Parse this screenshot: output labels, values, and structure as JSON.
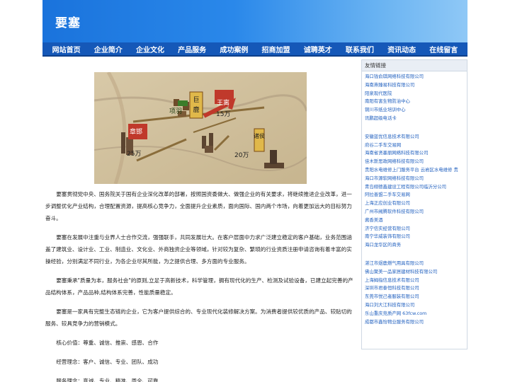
{
  "site": {
    "brand": "要塞"
  },
  "nav": [
    "网站首页",
    "企业简介",
    "企业文化",
    "产品服务",
    "成功案例",
    "招商加盟",
    "诚聘英才",
    "联系我们",
    "资讯动态",
    "在线留言"
  ],
  "hero": {
    "labels": {
      "a": "项羽",
      "b": "巨鹿",
      "c": "王离",
      "d": "15万",
      "e": "章邯",
      "f": "25万",
      "g": "诸侯",
      "h": "20万"
    }
  },
  "paragraphs": [
    "要塞贯彻党中央、国务院关于国有企业深化改革的部署，按照国资委做大、做强企业的有关要求，将继续推进企业改革，进一步调整优化产业结构，合理配置资源，提高核心竞争力，全面提升企业素质，面向国际、国内两个市场，向着更加远大的目标努力奋斗。",
    "要塞在发展中注重与业界人士合作交流，强强联手，共同发展壮大。在客户层面中力求广泛建立稳定的客户基础，业务范围涵盖了建筑业、设计业、工业、制造业、文化业、外商独资企业等领域，针对较为复杂、繁琐的行业资质注册申请咨询有着丰富的实操经验，分别满足不同行业，为各企业尽其所能，为之提供合理、多方面的专业服务。",
    "要塞秉承\"质量为本，服务社会\"的原则,立足于高新技术，科学管理，拥有现代化的生产、检测及试验设备，已建立起完善的产品结构体系，产品品种,结构体系完善，性能质量稳定。",
    "要塞是一家具有完整生态链的企业，它为客户提供综合的、专业现代化装修解决方案。为消费者提供较优质的产品、较贴切的服务、较具竞争力的营销模式。",
    "核心价值：尊重、诚信、推崇、感恩、合作",
    "经营理念：客户、诚信、专业、团队、成功",
    "服务理念：真诚、专业、精准、周全、可靠"
  ],
  "sidebar": {
    "title": "友情链接",
    "group1": [
      "海口钱俞琪网络科技有限公司",
      "海南燕臻易科技有限公司",
      "阳泉现代医院",
      "南阳有害生物防治中心",
      "铜川市纸业培训中心",
      "讯鹏超级电话卡"
    ],
    "group2": [
      "安徽蓝优信息技术有限公司",
      "府谷二手车交易网",
      "海南省贤墨丽网络科技有限公司",
      "佳木斯思政网络科技有限公司",
      "贵阳水电维修上门服务平台 云岩区水电维修 贵",
      "海口市源软网络科技有限公司",
      "青岛栩德鑫建设工程有限公司临沂分公司",
      "阿拉善盟二手车交易网",
      "上海正应创业有限公司",
      "广州市阙腾软件科技有限公司",
      "酱香美酒",
      "济宁信实经营有限公司",
      "南宁华威装饰有限公司",
      "海口龙华区的商务"
    ],
    "group3": [
      "湛江市煜鹿燃气用具有限公司",
      "佛山聚美一品家居建材科技有限公司",
      "上海姆指信息技术有限公司",
      "深圳市君泰恒科技有限公司",
      "东莞市悦己者服装有限公司",
      "海口刘大江科技有限公司",
      "乐山重庆竞质产网 63fcw.com",
      "成都市鑫怡物业服务有限公司"
    ]
  }
}
